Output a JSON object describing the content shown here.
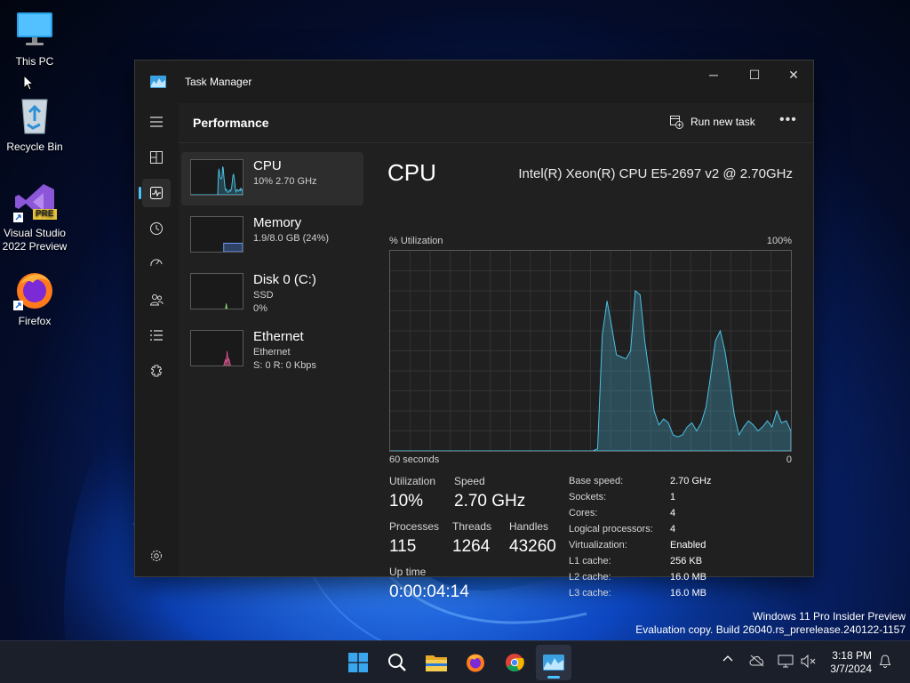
{
  "desktop": {
    "icons": [
      {
        "label": "This PC",
        "icon": "monitor-icon"
      },
      {
        "label": "Recycle Bin",
        "icon": "recycle-bin-icon"
      },
      {
        "label": "Visual Studio 2022 Preview",
        "icon": "visual-studio-icon",
        "badge": "PRE"
      },
      {
        "label": "Firefox",
        "icon": "firefox-icon"
      }
    ],
    "watermark": {
      "line1": "Windows 11 Pro Insider Preview",
      "line2": "Evaluation copy. Build 26040.rs_prerelease.240122-1157"
    }
  },
  "window": {
    "title": "Task Manager",
    "controls": {
      "minimize": "─",
      "maximize": "☐",
      "close": "✕"
    },
    "nav": [
      {
        "name": "hamburger-menu-icon"
      },
      {
        "name": "processes-icon"
      },
      {
        "name": "performance-icon",
        "active": true
      },
      {
        "name": "app-history-icon"
      },
      {
        "name": "startup-apps-icon"
      },
      {
        "name": "users-icon"
      },
      {
        "name": "details-icon"
      },
      {
        "name": "services-icon"
      },
      {
        "name": "settings-icon"
      }
    ],
    "header": {
      "title": "Performance",
      "run_new_task": "Run new task",
      "more": "•••"
    },
    "resources": [
      {
        "name": "CPU",
        "line1": "10% 2.70 GHz",
        "line2": "",
        "selected": true
      },
      {
        "name": "Memory",
        "line1": "1.9/8.0 GB (24%)",
        "line2": ""
      },
      {
        "name": "Disk 0 (C:)",
        "line1": "SSD",
        "line2": "0%"
      },
      {
        "name": "Ethernet",
        "line1": "Ethernet",
        "line2": "S: 0 R: 0 Kbps"
      }
    ],
    "detail": {
      "title": "CPU",
      "cpu_name": "Intel(R) Xeon(R) CPU E5-2697 v2 @ 2.70GHz",
      "graph_top_left": "% Utilization",
      "graph_top_right": "100%",
      "graph_bottom_left": "60 seconds",
      "graph_bottom_right": "0",
      "graph_color": "#4cc2e6",
      "utilization_series": [
        0,
        0,
        0,
        0,
        0,
        0,
        0,
        0,
        0,
        0,
        0,
        0,
        0,
        0,
        0,
        0,
        0,
        0,
        0,
        0,
        0,
        0,
        0,
        0,
        0,
        0,
        0,
        0,
        0,
        0,
        0,
        0,
        0,
        0,
        0,
        0,
        0,
        0,
        0,
        0,
        0,
        0,
        0,
        0,
        1,
        58,
        75,
        62,
        48,
        47,
        46,
        50,
        80,
        78,
        55,
        38,
        20,
        13,
        16,
        14,
        8,
        7,
        8,
        12,
        14,
        10,
        14,
        22,
        38,
        55,
        60,
        50,
        35,
        18,
        8,
        12,
        15,
        13,
        10,
        12,
        15,
        12,
        20,
        14,
        15,
        10
      ],
      "stats": {
        "utilization_label": "Utilization",
        "utilization_value": "10%",
        "speed_label": "Speed",
        "speed_value": "2.70 GHz",
        "processes_label": "Processes",
        "processes_value": "115",
        "threads_label": "Threads",
        "threads_value": "1264",
        "handles_label": "Handles",
        "handles_value": "43260",
        "uptime_label": "Up time",
        "uptime_value": "0:00:04:14"
      },
      "specs": [
        {
          "k": "Base speed:",
          "v": "2.70 GHz"
        },
        {
          "k": "Sockets:",
          "v": "1"
        },
        {
          "k": "Cores:",
          "v": "4"
        },
        {
          "k": "Logical processors:",
          "v": "4"
        },
        {
          "k": "Virtualization:",
          "v": "Enabled"
        },
        {
          "k": "L1 cache:",
          "v": "256 KB"
        },
        {
          "k": "L2 cache:",
          "v": "16.0 MB"
        },
        {
          "k": "L3 cache:",
          "v": "16.0 MB"
        }
      ]
    }
  },
  "taskbar": {
    "apps": [
      "start-icon",
      "search-icon",
      "file-explorer-icon",
      "firefox-icon",
      "chrome-icon",
      "task-manager-icon"
    ],
    "active_app": "task-manager-icon",
    "time": "3:18 PM",
    "date": "3/7/2024"
  }
}
